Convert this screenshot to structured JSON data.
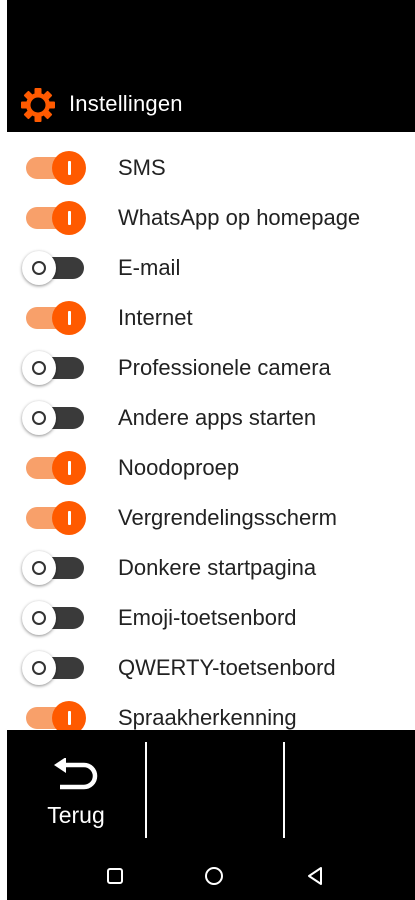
{
  "header": {
    "title": "Instellingen",
    "icon": "gear-icon",
    "icon_color": "#ff5a00"
  },
  "settings": [
    {
      "label": "SMS",
      "on": true
    },
    {
      "label": "WhatsApp op homepage",
      "on": true
    },
    {
      "label": "E-mail",
      "on": false
    },
    {
      "label": "Internet",
      "on": true
    },
    {
      "label": "Professionele camera",
      "on": false
    },
    {
      "label": "Andere apps starten",
      "on": false
    },
    {
      "label": "Noodoproep",
      "on": true
    },
    {
      "label": "Vergrendelingsscherm",
      "on": true
    },
    {
      "label": "Donkere startpagina",
      "on": false
    },
    {
      "label": "Emoji-toetsenbord",
      "on": false
    },
    {
      "label": "QWERTY-toetsenbord",
      "on": false
    },
    {
      "label": "Spraakherkenning",
      "on": true
    }
  ],
  "bottom": {
    "back_label": "Terug",
    "back_icon": "return-arrow-icon"
  },
  "nav": {
    "icons": [
      "recents-square-icon",
      "home-circle-icon",
      "back-triangle-icon"
    ]
  },
  "colors": {
    "accent": "#ff5a00",
    "track_on": "#f8a06a",
    "track_off": "#3a3a3a",
    "header_bg": "#000000"
  }
}
